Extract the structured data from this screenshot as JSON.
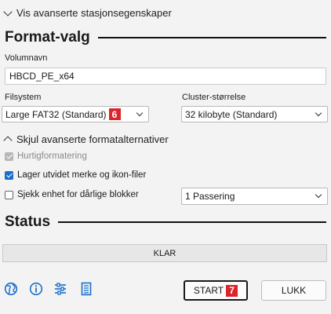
{
  "advanced_drive": {
    "label": "Vis avanserte stasjonsegenskaper"
  },
  "format": {
    "title": "Format-valg",
    "volume_label": "Volumnavn",
    "volume_value": "HBCD_PE_x64",
    "filesystem_label": "Filsystem",
    "filesystem_value": "Large FAT32 (Standard)",
    "filesystem_badge": "6",
    "cluster_label": "Cluster-størrelse",
    "cluster_value": "32 kilobyte (Standard)",
    "hide_advanced": "Skjul avanserte formatalternativer",
    "quick_format": {
      "label": "Hurtigformatering",
      "checked": true,
      "disabled": true
    },
    "extended_label": {
      "label": "Lager utvidet merke og ikon-filer",
      "checked": true
    },
    "bad_blocks": {
      "label": "Sjekk enhet for dårlige blokker",
      "checked": false
    },
    "passes_value": "1 Passering"
  },
  "status": {
    "title": "Status",
    "progress_text": "KLAR",
    "progress": 0
  },
  "footer": {
    "icons": [
      "globe-icon",
      "info-icon",
      "settings-sliders-icon",
      "log-icon"
    ],
    "start_label": "START",
    "start_badge": "7",
    "close_label": "LUKK"
  },
  "colors": {
    "accent": "#1a6fc9",
    "badge": "#d9262c"
  }
}
